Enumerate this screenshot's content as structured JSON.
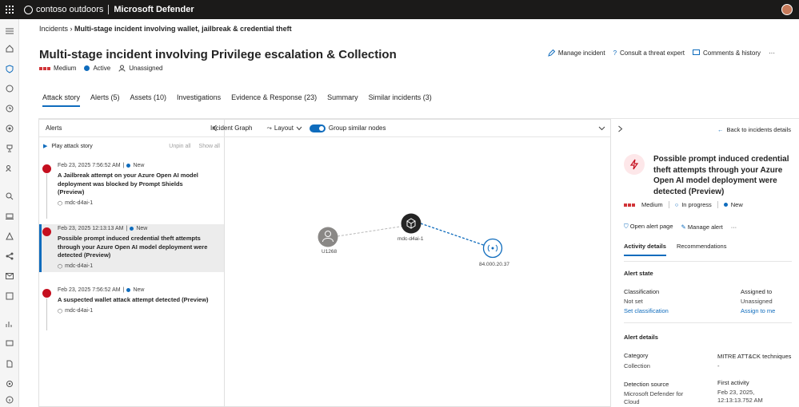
{
  "topbar": {
    "brand": "contoso outdoors",
    "product": "Microsoft Defender"
  },
  "breadcrumb": {
    "root": "Incidents",
    "current": "Multi-stage incident involving wallet, jailbreak & credential theft"
  },
  "incident": {
    "title": "Multi-stage incident involving Privilege escalation & Collection",
    "severity": "Medium",
    "status": "Active",
    "assignee": "Unassigned"
  },
  "actions": {
    "manage": "Manage incident",
    "consult": "Consult a threat expert",
    "comments": "Comments & history",
    "more": "···"
  },
  "tabs": [
    "Attack story",
    "Alerts (5)",
    "Assets (10)",
    "Investigations",
    "Evidence & Response (23)",
    "Summary",
    "Similar incidents (3)"
  ],
  "alerts_panel": {
    "title": "Alerts",
    "play": "Play attack story",
    "unpin": "Unpin all",
    "show": "Show all",
    "items": [
      {
        "time": "Feb 23, 2025 7:56:52 AM",
        "status": "New",
        "title": "A Jailbreak attempt on your Azure Open AI model deployment was blocked by Prompt Shields (Preview)",
        "source": "mdc-d4ai-1"
      },
      {
        "time": "Feb 23, 2025 12:13:13 AM",
        "status": "New",
        "title": "Possible prompt induced credential theft attempts through your Azure Open AI model deployment were detected (Preview)",
        "source": "mdc-d4ai-1"
      },
      {
        "time": "Feb 23, 2025 7:56:52 AM",
        "status": "New",
        "title": "A suspected wallet attack attempt detected (Preview)",
        "source": "mdc-d4ai-1"
      }
    ]
  },
  "graph": {
    "title": "Incident Graph",
    "layout": "Layout",
    "group": "Group similar nodes",
    "nodes": {
      "user": "U1268",
      "resource": "mdc-d4ai-1",
      "ip": "84.000.20.37"
    }
  },
  "details": {
    "back": "Back to incidents details",
    "title": "Possible prompt induced credential theft attempts through your Azure Open AI model deployment were detected (Preview)",
    "severity": "Medium",
    "state": "In progress",
    "status": "New",
    "open": "Open alert page",
    "manage": "Manage alert",
    "more": "···",
    "tabs": [
      "Activity details",
      "Recommendations"
    ],
    "alert_state": "Alert state",
    "classification_label": "Classification",
    "classification_value": "Not set",
    "set_classification": "Set classification",
    "assigned_label": "Assigned to",
    "assigned_value": "Unassigned",
    "assign_me": "Assign to me",
    "alert_details": "Alert details",
    "category_label": "Category",
    "category_value": "Collection",
    "mitre_label": "MITRE ATT&CK techniques",
    "mitre_value": "-",
    "detection_label": "Detection source",
    "detection_value": "Microsoft Defender for Cloud",
    "first_label": "First activity",
    "first_value": "Feb 23, 2025, 12:13:13.752 AM"
  },
  "colors": {
    "accent": "#0f6cbd",
    "severity": "#d13438",
    "alert": "#c50f1f"
  }
}
